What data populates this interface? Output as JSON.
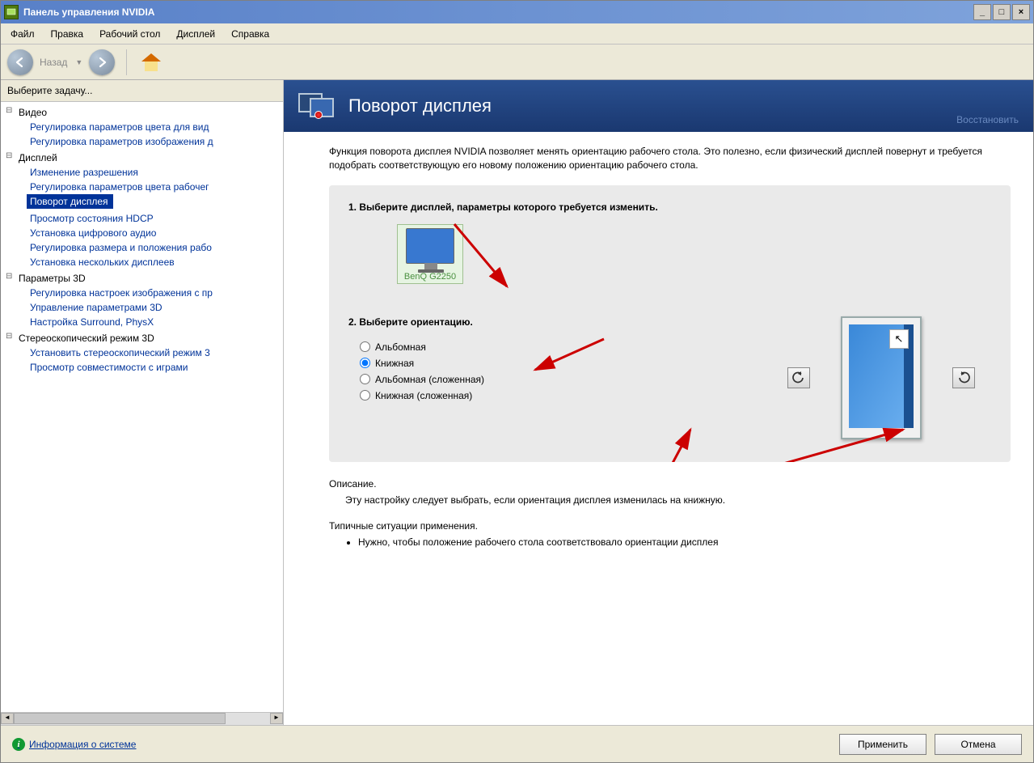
{
  "window": {
    "title": "Панель управления NVIDIA"
  },
  "menu": {
    "file": "Файл",
    "edit": "Правка",
    "desktop": "Рабочий стол",
    "display": "Дисплей",
    "help": "Справка"
  },
  "toolbar": {
    "back": "Назад"
  },
  "sidebar": {
    "head": "Выберите задачу...",
    "groups": [
      {
        "title": "Видео",
        "items": [
          "Регулировка параметров цвета для вид",
          "Регулировка параметров изображения д"
        ]
      },
      {
        "title": "Дисплей",
        "items": [
          "Изменение разрешения",
          "Регулировка параметров цвета рабочег",
          "Поворот дисплея",
          "Просмотр состояния HDCP",
          "Установка цифрового аудио",
          "Регулировка размера и положения рабо",
          "Установка нескольких дисплеев"
        ],
        "selected_index": 2
      },
      {
        "title": "Параметры 3D",
        "items": [
          "Регулировка настроек изображения с пр",
          "Управление параметрами 3D",
          "Настройка Surround, PhysX"
        ]
      },
      {
        "title": "Стереоскопический режим 3D",
        "items": [
          "Установить стереоскопический режим 3",
          "Просмотр совместимости с играми"
        ]
      }
    ]
  },
  "main": {
    "title": "Поворот дисплея",
    "restore": "Восстановить",
    "intro": "Функция поворота дисплея NVIDIA позволяет менять ориентацию рабочего стола. Это полезно, если физический дисплей повернут и требуется подобрать соответствующую его новому положению ориентацию рабочего стола.",
    "step1": "1. Выберите дисплей, параметры которого требуется изменить.",
    "display_name": "BenQ G2250",
    "step2": "2. Выберите ориентацию.",
    "orientations": [
      {
        "label": "Альбомная",
        "checked": false
      },
      {
        "label": "Книжная",
        "checked": true
      },
      {
        "label": "Альбомная (сложенная)",
        "checked": false
      },
      {
        "label": "Книжная (сложенная)",
        "checked": false
      }
    ],
    "desc_title": "Описание.",
    "desc_text": "Эту настройку следует выбрать, если ориентация дисплея изменилась на книжную.",
    "use_title": "Типичные ситуации применения.",
    "use_bullet": "Нужно, чтобы положение рабочего стола соответствовало ориентации дисплея"
  },
  "footer": {
    "info": "Информация о системе",
    "apply": "Применить",
    "cancel": "Отмена"
  }
}
